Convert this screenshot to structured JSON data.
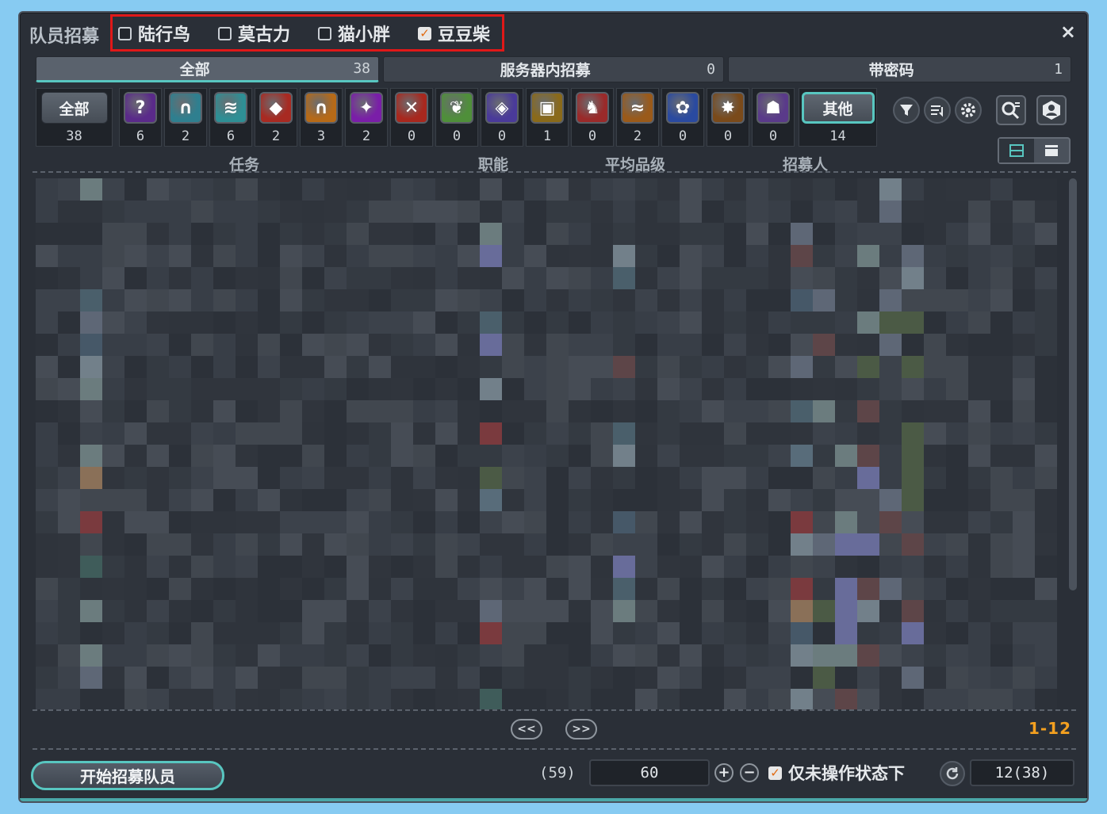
{
  "window": {
    "title": "队员招募",
    "close": "×"
  },
  "characters": [
    {
      "name": "陆行鸟",
      "checked": false
    },
    {
      "name": "莫古力",
      "checked": false
    },
    {
      "name": "猫小胖",
      "checked": false
    },
    {
      "name": "豆豆柴",
      "checked": true
    }
  ],
  "tabs": [
    {
      "label": "全部",
      "count": "38",
      "active": true
    },
    {
      "label": "服务器内招募",
      "count": "0",
      "active": false
    },
    {
      "label": "带密码",
      "count": "1",
      "active": false
    }
  ],
  "categories": {
    "all": {
      "label": "全部",
      "count": "38"
    },
    "icons": [
      {
        "icon": "question-icon",
        "count": "6",
        "color": "#5a2a8a"
      },
      {
        "icon": "gate-icon",
        "count": "2",
        "color": "#2f7f8f"
      },
      {
        "icon": "scroll-icon",
        "count": "6",
        "color": "#2e8f95"
      },
      {
        "icon": "mask-icon",
        "count": "2",
        "color": "#a82a22"
      },
      {
        "icon": "arch-icon",
        "count": "3",
        "color": "#b66a18"
      },
      {
        "icon": "demon-icon",
        "count": "2",
        "color": "#7a1ea8"
      },
      {
        "icon": "crossed-swords-icon",
        "count": "0",
        "color": "#a8281e"
      },
      {
        "icon": "leaf-icon",
        "count": "0",
        "color": "#4f8f3a"
      },
      {
        "icon": "orb-icon",
        "count": "0",
        "color": "#4a3a9a"
      },
      {
        "icon": "treasure-chest-icon",
        "count": "1",
        "color": "#8a6a1a"
      },
      {
        "icon": "figure-icon",
        "count": "0",
        "color": "#9a2a2a"
      },
      {
        "icon": "fish-icon",
        "count": "2",
        "color": "#9a5a1a"
      },
      {
        "icon": "flower-icon",
        "count": "0",
        "color": "#2a4aa0"
      },
      {
        "icon": "star-burst-icon",
        "count": "0",
        "color": "#7a4a1a"
      },
      {
        "icon": "party-icon",
        "count": "0",
        "color": "#5a3a8a"
      }
    ],
    "other": {
      "label": "其他",
      "count": "14"
    }
  },
  "columns": {
    "duty": "任务",
    "job": "职能",
    "avg_ilvl": "平均品级",
    "recruiter": "招募人"
  },
  "pager": {
    "prev": "<<",
    "next": ">>",
    "range": "1-12"
  },
  "footer": {
    "start_button": "开始招募队员",
    "paren_value": "(59)",
    "input_value": "60",
    "plus": "+",
    "minus": "−",
    "only_label": "仅未操作状态下",
    "only_checked": true,
    "result_count": "12(38)"
  },
  "colors": {
    "accent": "#58c6c0",
    "highlight_border": "#e01818",
    "range": "#f3a020",
    "check": "#e06a10"
  }
}
